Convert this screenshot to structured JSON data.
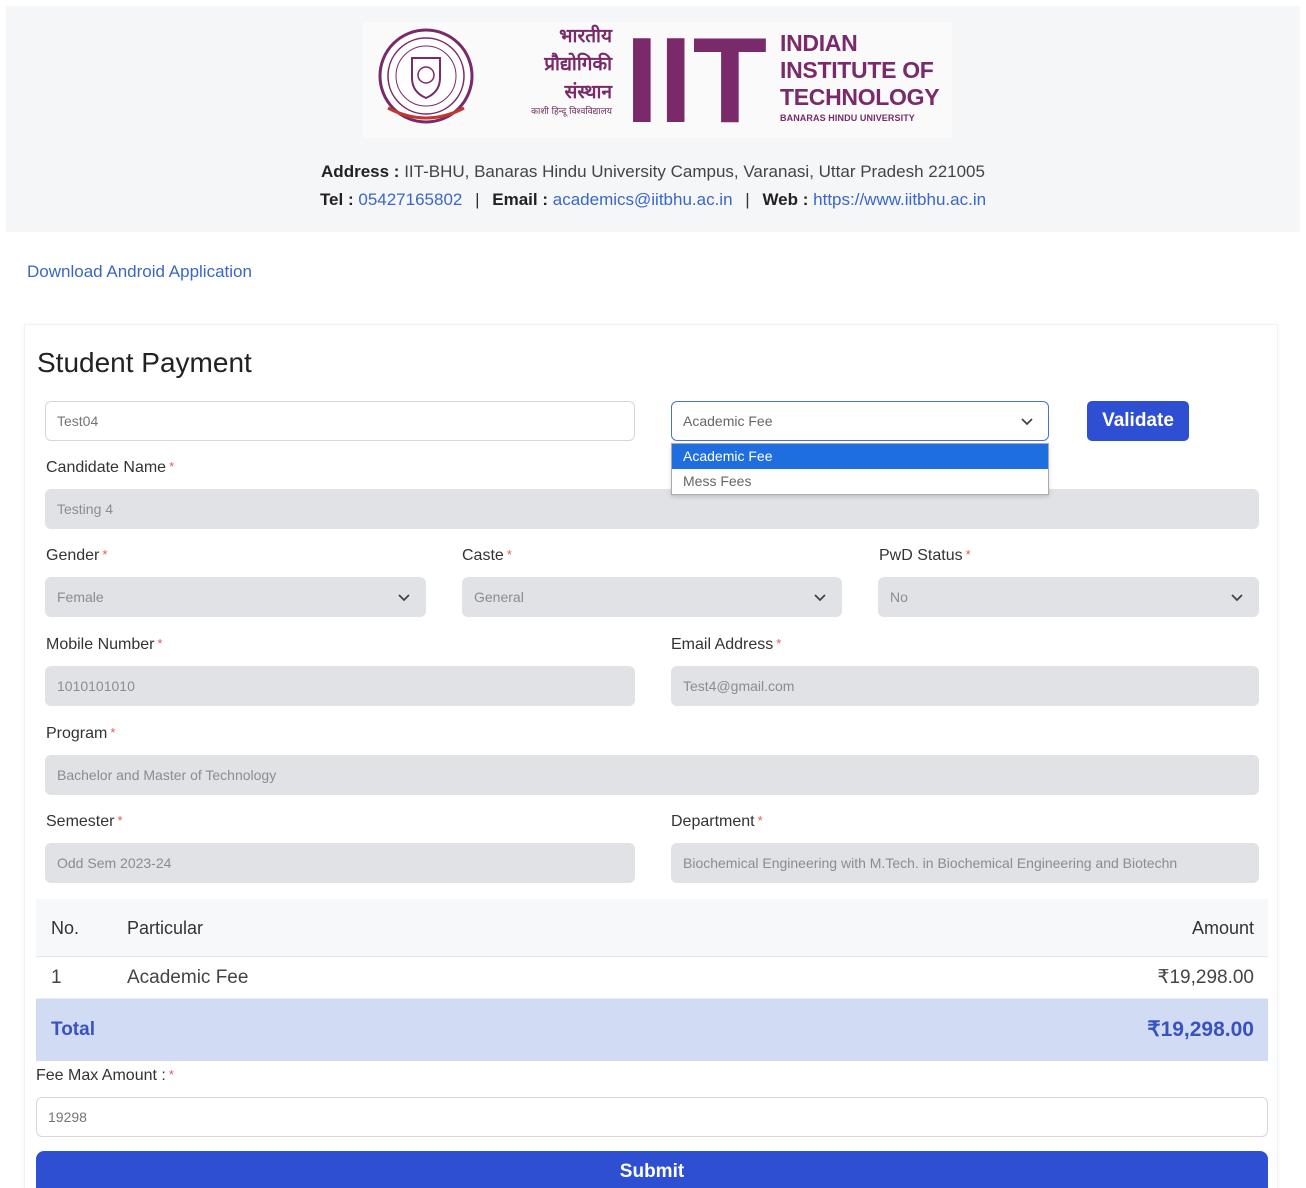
{
  "header": {
    "logo": {
      "hindi_lines": [
        "भारतीय",
        "प्रौद्योगिकी",
        "संस्थान"
      ],
      "hindi_sub": "काशी हिन्दू विश्वविद्यालय",
      "letters": "IIT",
      "english_lines": [
        "INDIAN",
        "INSTITUTE OF",
        "TECHNOLOGY"
      ],
      "english_sub": "BANARAS HINDU UNIVERSITY"
    },
    "address_label": "Address :",
    "address": "IIT-BHU, Banaras Hindu University Campus, Varanasi, Uttar Pradesh 221005",
    "tel_label": "Tel :",
    "tel": "05427165802",
    "email_label": "Email :",
    "email": "academics@iitbhu.ac.in",
    "web_label": "Web :",
    "web": "https://www.iitbhu.ac.in",
    "separator": "|"
  },
  "download_link": "Download Android Application",
  "form": {
    "title": "Student Payment",
    "roll_value": "Test04",
    "fee_type_selected": "Academic Fee",
    "fee_type_options": [
      "Academic Fee",
      "Mess Fees"
    ],
    "validate_label": "Validate",
    "candidate_name_label": "Candidate Name",
    "candidate_name_value": "Testing 4",
    "gender_label": "Gender",
    "gender_value": "Female",
    "caste_label": "Caste",
    "caste_value": "General",
    "pwd_label": "PwD Status",
    "pwd_value": "No",
    "mobile_label": "Mobile Number",
    "mobile_value": "1010101010",
    "email_label": "Email Address",
    "email_value": "Test4@gmail.com",
    "program_label": "Program",
    "program_value": "Bachelor and Master of Technology",
    "semester_label": "Semester",
    "semester_value": "Odd Sem 2023-24",
    "department_label": "Department",
    "department_value": "Biochemical Engineering with M.Tech. in Biochemical Engineering and Biotechn",
    "required_mark": "*"
  },
  "fee_table": {
    "headers": {
      "no": "No.",
      "particular": "Particular",
      "amount": "Amount"
    },
    "rows": [
      {
        "no": "1",
        "particular": "Academic Fee",
        "amount": "₹19,298.00"
      }
    ],
    "total_label": "Total",
    "total_value": "₹19,298.00"
  },
  "fee_max": {
    "label": "Fee Max Amount :",
    "value": "19298"
  },
  "submit_label": "Submit",
  "colors": {
    "primary": "#2f4fd3",
    "link": "#3a66c9",
    "logo_purple": "#7a2a6a",
    "total_bg": "#d2dbf4",
    "readonly_bg": "#e0e2e5",
    "required": "#e25a5a"
  },
  "icons": {
    "dropdown": "chevron-down-icon",
    "seal": "institute-seal-icon"
  }
}
